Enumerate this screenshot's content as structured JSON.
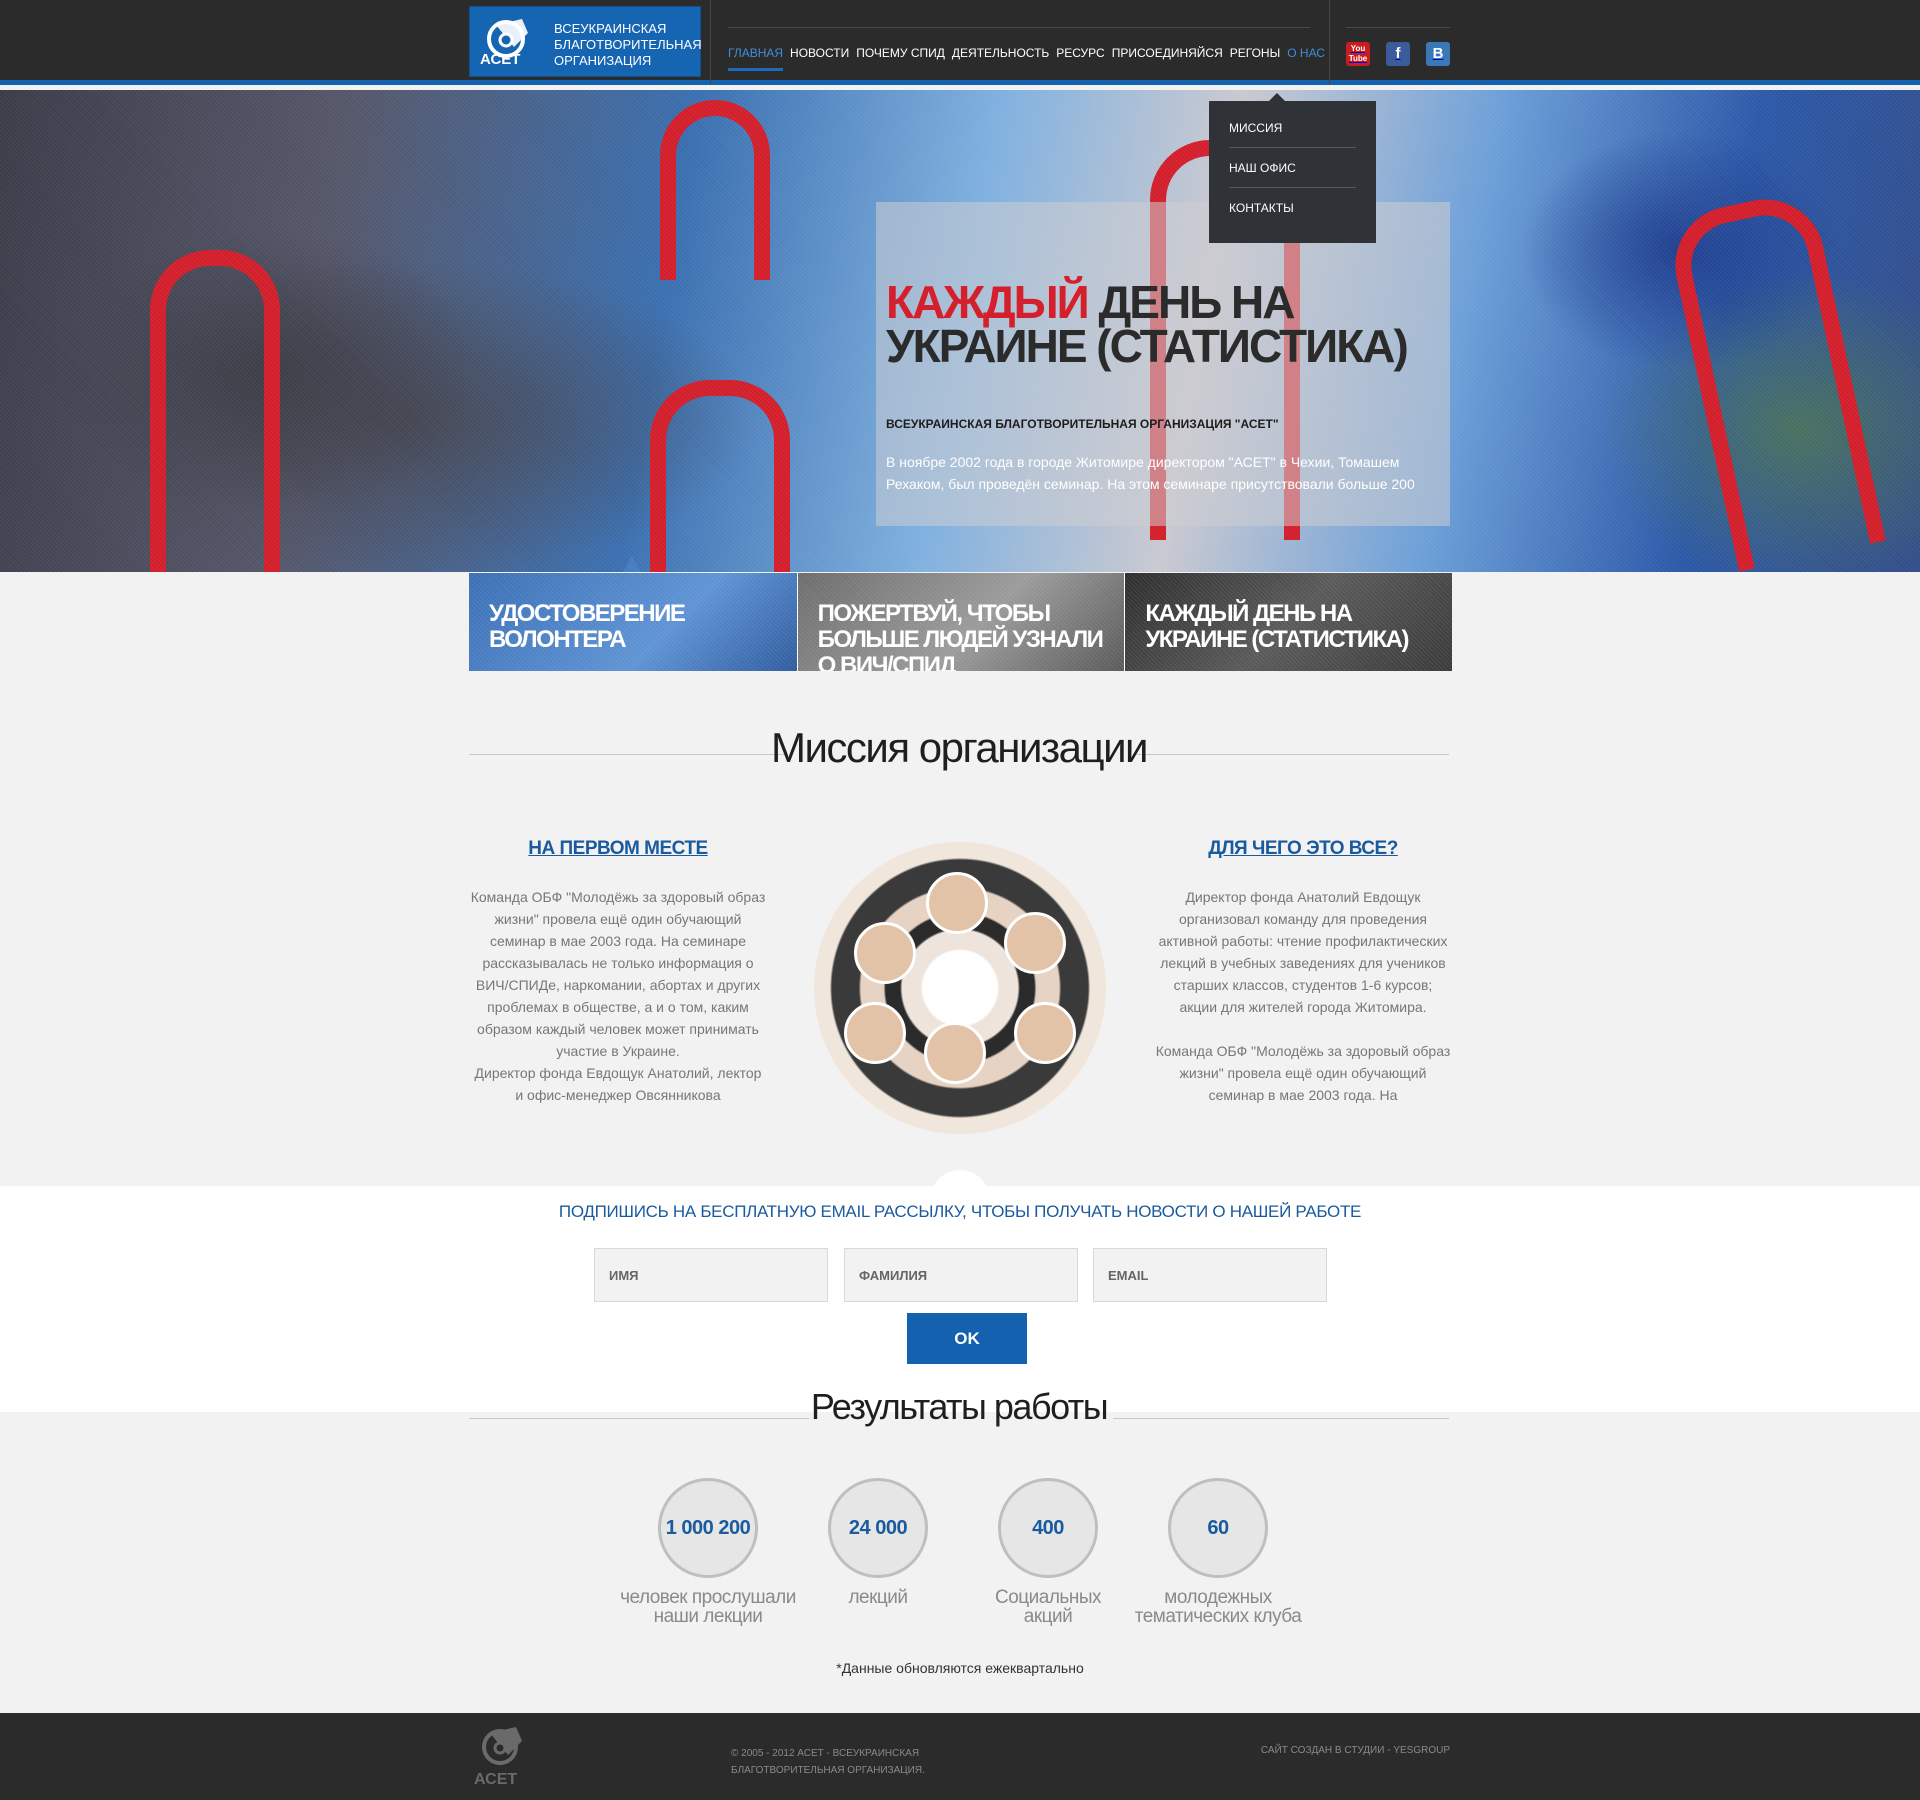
{
  "header": {
    "logo": {
      "org_line1": "ВСЕУКРАИНСКАЯ",
      "org_line2": "БЛАГОТВОРИТЕЛЬНАЯ",
      "org_line3": "ОРГАНИЗАЦИЯ",
      "brand": "АСЕТ"
    },
    "nav": [
      "ГЛАВНАЯ",
      "НОВОСТИ",
      "ПОЧЕМУ СПИД",
      "ДЕЯТЕЛЬНОСТЬ",
      "РЕСУРС",
      "ПРИСОЕДИНЯЙСЯ",
      "РЕГОНЫ",
      "О НАС"
    ],
    "social": {
      "youtube": "You Tube",
      "facebook": "f",
      "vk": "B"
    }
  },
  "dropdown": [
    "МИССИЯ",
    "НАШ ОФИС",
    "КОНТАКТЫ"
  ],
  "hero": {
    "title_red": "КАЖДЫЙ",
    "title_rest": " ДЕНЬ НА УКРАИНЕ (СТАТИСТИКА)",
    "subtitle": "ВСЕУКРАИНСКАЯ БЛАГОТВОРИТЕЛЬНАЯ ОРГАНИЗАЦИЯ \"АСЕТ\"",
    "text": "В ноябре 2002 года в городе Житомире директором \"АСЕТ\" в Чехии, Томашем Рехаком, был проведён семинар. На этом семинаре присутствовали больше 200"
  },
  "tiles": [
    "УДОСТОВЕРЕНИЕ ВОЛОНТЕРА",
    "ПОЖЕРТВУЙ, ЧТОБЫ БОЛЬШЕ ЛЮДЕЙ УЗНАЛИ О ВИЧ/СПИД",
    "КАЖДЫЙ ДЕНЬ НА УКРАИНЕ (СТАТИСТИКА)"
  ],
  "mission": {
    "heading": "Миссия организации",
    "left_title": "НА ПЕРВОМ МЕСТЕ",
    "left_text": "Команда ОБФ \"Молодёжь за здоровый образ жизни\" провела ещё один обучающий семинар в мае 2003 года. На семинаре рассказывалась не только информация о ВИЧ/СПИДе, наркомании, абортах и других проблемах в обществе, а и о том, каким образом каждый человек может принимать участие в Украине.\nДиректор фонда Евдощук Анатолий, лектор и офис-менеджер Овсянникова",
    "right_title": "ДЛЯ ЧЕГО ЭТО ВСЕ?",
    "right_text": "Директор фонда Анатолий Евдощук организовал команду для проведения активной работы: чтение профилактических лекций в учебных заведениях для учеников старших классов, студентов 1-6 курсов; акции для жителей города Житомира.\n\nКоманда ОБФ \"Молодёжь за здоровый образ жизни\" провела ещё один обучающий семинар в мае 2003 года. На"
  },
  "subscribe": {
    "title": "ПОДПИШИСЬ НА БЕСПЛАТНУЮ EMAIL РАССЫЛКУ, ЧТОБЫ ПОЛУЧАТЬ НОВОСТИ О НАШЕЙ РАБОТЕ",
    "first_name_placeholder": "ИМЯ",
    "last_name_placeholder": "ФАМИЛИЯ",
    "email_placeholder": "EMAIL",
    "ok_label": "OK"
  },
  "results": {
    "heading": "Результаты работы",
    "stats": [
      {
        "value": "1 000 200",
        "label": "человек прослушали\nнаши лекции"
      },
      {
        "value": "24 000",
        "label": "лекций"
      },
      {
        "value": "400",
        "label": "Социальных\nакций"
      },
      {
        "value": "60",
        "label": "молодежных\nтематических клуба"
      }
    ],
    "note": "*Данные обновляются ежеквартально"
  },
  "footer": {
    "brand": "АСЕТ",
    "copyright": "© 2005 - 2012 АСЕТ - ВСЕУКРАИНСКАЯ БЛАГОТВОРИТЕЛЬНАЯ ОРГАНИЗАЦИЯ.",
    "studio": "САЙТ СОЗДАН В СТУДИИ - YESGROUP"
  },
  "colors": {
    "accent": "#1461b0",
    "hero_red": "#d4202c",
    "header_bg": "#2b2b2b"
  }
}
